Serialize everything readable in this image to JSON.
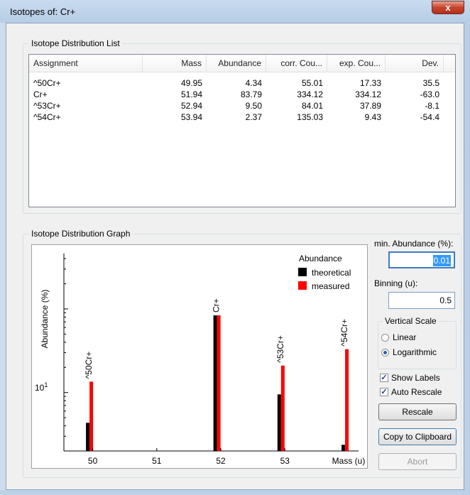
{
  "window": {
    "title": "Isotopes of: Cr+",
    "close_glyph": "x"
  },
  "list_group": {
    "title": "Isotope Distribution List",
    "columns": [
      "Assignment",
      "Mass",
      "Abundance",
      "corr. Cou...",
      "exp. Cou...",
      "Dev."
    ],
    "rows": [
      [
        "^50Cr+",
        "49.95",
        "4.34",
        "55.01",
        "17.33",
        "35.5"
      ],
      [
        "Cr+",
        "51.94",
        "83.79",
        "334.12",
        "334.12",
        "-63.0"
      ],
      [
        "^53Cr+",
        "52.94",
        "9.50",
        "84.01",
        "37.89",
        "-8.1"
      ],
      [
        "^54Cr+",
        "53.94",
        "2.37",
        "135.03",
        "9.43",
        "-54.4"
      ]
    ]
  },
  "graph_group": {
    "title": "Isotope Distribution Graph"
  },
  "chart_data": {
    "type": "bar",
    "y_scale": "log",
    "xlabel": "Mass (u)",
    "ylabel": "Abundance (%)",
    "x_ticks": [
      "50",
      "51",
      "52",
      "53"
    ],
    "y_tick_label": "10",
    "y_tick_exp": "1",
    "legend_title": "Abundance",
    "legend_position": "top-right",
    "series": [
      {
        "name": "theoretical",
        "color": "#000000",
        "points": [
          {
            "x": 49.95,
            "y": 4.34
          },
          {
            "x": 51.94,
            "y": 83.79
          },
          {
            "x": 52.94,
            "y": 9.5
          },
          {
            "x": 53.94,
            "y": 2.37
          }
        ]
      },
      {
        "name": "measured",
        "color": "#ff0000",
        "points": [
          {
            "x": 49.95,
            "y": 13.5
          },
          {
            "x": 51.94,
            "y": 83.79
          },
          {
            "x": 52.94,
            "y": 21
          },
          {
            "x": 53.94,
            "y": 33
          }
        ]
      }
    ],
    "peak_labels": [
      {
        "x": 49.95,
        "text": "^50Cr+"
      },
      {
        "x": 51.94,
        "text": "Cr+"
      },
      {
        "x": 52.94,
        "text": "^53Cr+"
      },
      {
        "x": 53.94,
        "text": "^54Cr+"
      }
    ]
  },
  "controls": {
    "min_abundance_label": "min. Abundance (%):",
    "min_abundance_value": "0.01",
    "binning_label": "Binning (u):",
    "binning_value": "0.5",
    "vertical_scale_title": "Vertical Scale",
    "linear_label": "Linear",
    "log_label": "Logarithmic",
    "scale_selected": "Logarithmic",
    "show_labels_label": "Show Labels",
    "show_labels_checked": true,
    "auto_rescale_label": "Auto Rescale",
    "auto_rescale_checked": true,
    "rescale_button": "Rescale",
    "copy_button": "Copy to Clipboard",
    "abort_button": "Abort"
  }
}
